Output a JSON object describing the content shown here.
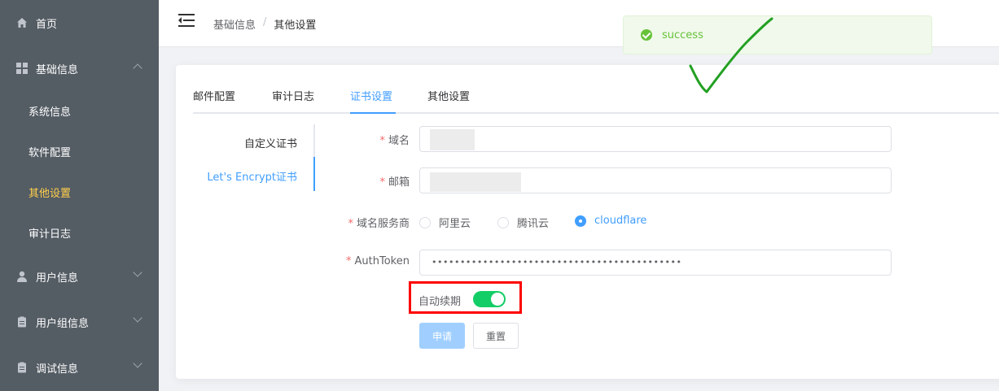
{
  "sidebar": {
    "items": [
      {
        "label": "首页",
        "icon": "home-icon"
      },
      {
        "label": "基础信息",
        "icon": "grid-icon"
      },
      {
        "label": "用户信息",
        "icon": "user-icon"
      },
      {
        "label": "用户组信息",
        "icon": "clipboard-icon"
      },
      {
        "label": "调试信息",
        "icon": "clipboard-icon"
      }
    ],
    "sub_items": [
      "系统信息",
      "软件配置",
      "其他设置",
      "审计日志"
    ],
    "active_sub": "其他设置",
    "active_color": "#ffd04b",
    "bg_color": "#545c64"
  },
  "header": {
    "breadcrumb": [
      "基础信息",
      "其他设置"
    ],
    "separator": "/"
  },
  "toast": {
    "message": "success"
  },
  "tabs": [
    {
      "label": "邮件配置"
    },
    {
      "label": "审计日志"
    },
    {
      "label": "证书设置"
    },
    {
      "label": "其他设置"
    }
  ],
  "active_tab": "证书设置",
  "vtabs": [
    {
      "label": "自定义证书"
    },
    {
      "label": "Let's Encrypt证书"
    }
  ],
  "active_vtab": "Let's Encrypt证书",
  "form": {
    "domain_label": "域名",
    "email_label": "邮箱",
    "provider_label": "域名服务商",
    "providers": [
      "阿里云",
      "腾讯云",
      "cloudflare"
    ],
    "selected_provider": "cloudflare",
    "token_label": "AuthToken",
    "token_value": "••••••••••••••••••••••••••••••••••••••••••••",
    "required_mark": "*",
    "auto_renew_label": "自动续期",
    "auto_renew_on": true,
    "submit_label": "申请",
    "reset_label": "重置"
  },
  "colors": {
    "primary": "#409eff",
    "success": "#67c23a",
    "switch_on": "#13ce66",
    "highlight_box": "#ff0000"
  }
}
